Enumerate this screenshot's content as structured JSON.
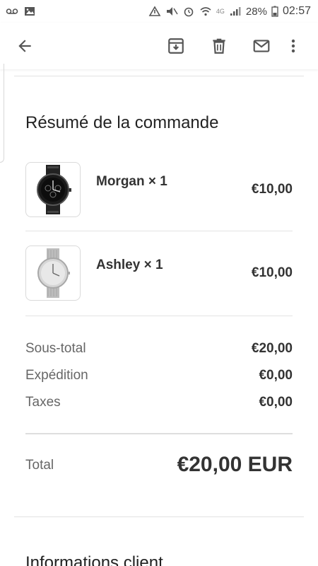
{
  "status_bar": {
    "battery": "28%",
    "time": "02:57",
    "network": "4G"
  },
  "order": {
    "title": "Résumé de la commande",
    "items": [
      {
        "name": "Morgan × 1",
        "price": "€10,00",
        "thumb_icon": "black-watch-icon"
      },
      {
        "name": "Ashley × 1",
        "price": "€10,00",
        "thumb_icon": "silver-watch-icon"
      }
    ],
    "summary": [
      {
        "label": "Sous-total",
        "value": "€20,00"
      },
      {
        "label": "Expédition",
        "value": "€0,00"
      },
      {
        "label": "Taxes",
        "value": "€0,00"
      }
    ],
    "total_label": "Total",
    "total_value": "€20,00 EUR"
  },
  "customer": {
    "title": "Informations client"
  }
}
